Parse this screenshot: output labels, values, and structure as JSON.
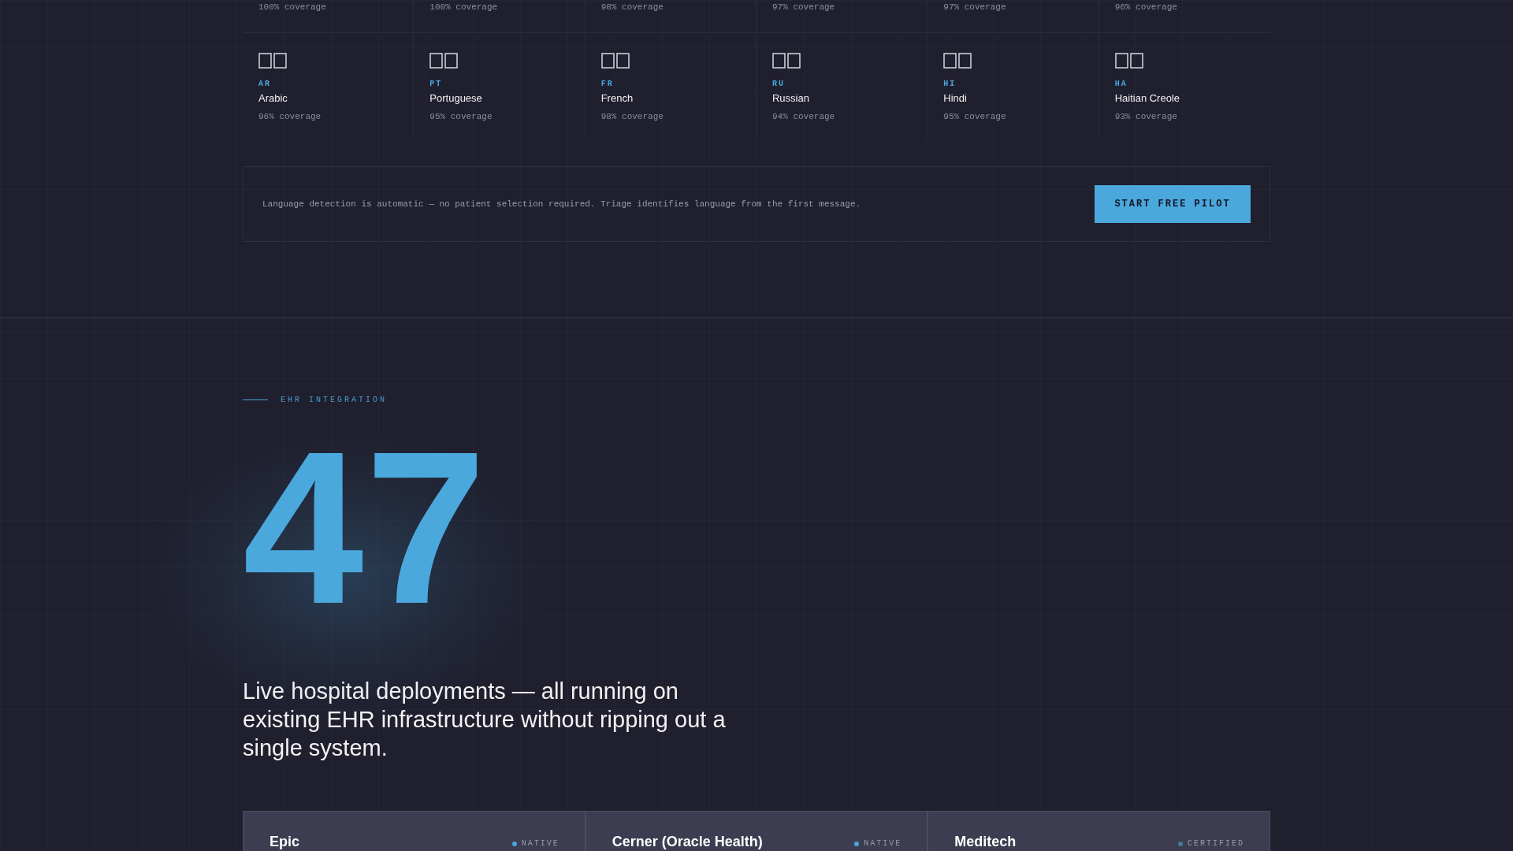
{
  "languages_top_row": [
    {
      "coverage": "100% coverage"
    },
    {
      "coverage": "100% coverage"
    },
    {
      "coverage": "98% coverage"
    },
    {
      "coverage": "97% coverage"
    },
    {
      "coverage": "97% coverage"
    },
    {
      "coverage": "96% coverage"
    }
  ],
  "languages": [
    {
      "code": "AR",
      "name": "Arabic",
      "coverage": "96% coverage"
    },
    {
      "code": "PT",
      "name": "Portuguese",
      "coverage": "95% coverage"
    },
    {
      "code": "FR",
      "name": "French",
      "coverage": "98% coverage"
    },
    {
      "code": "RU",
      "name": "Russian",
      "coverage": "94% coverage"
    },
    {
      "code": "HI",
      "name": "Hindi",
      "coverage": "95% coverage"
    },
    {
      "code": "HA",
      "name": "Haitian Creole",
      "coverage": "93% coverage"
    }
  ],
  "cta": {
    "text": "Language detection is automatic — no patient selection required. Triage identifies language from the first message.",
    "button": "START FREE PILOT"
  },
  "ehr": {
    "eyebrow": "EHR INTEGRATION",
    "stat": "47",
    "description": "Live hospital deployments — all running on existing EHR infrastructure without ripping out a single system."
  },
  "integrations": [
    {
      "name": "Epic",
      "badge": "NATIVE",
      "color": "#4aa8dc"
    },
    {
      "name": "Cerner (Oracle Health)",
      "badge": "NATIVE",
      "color": "#4aa8dc"
    },
    {
      "name": "Meditech",
      "badge": "CERTIFIED",
      "color": "#3f7e9c"
    }
  ]
}
